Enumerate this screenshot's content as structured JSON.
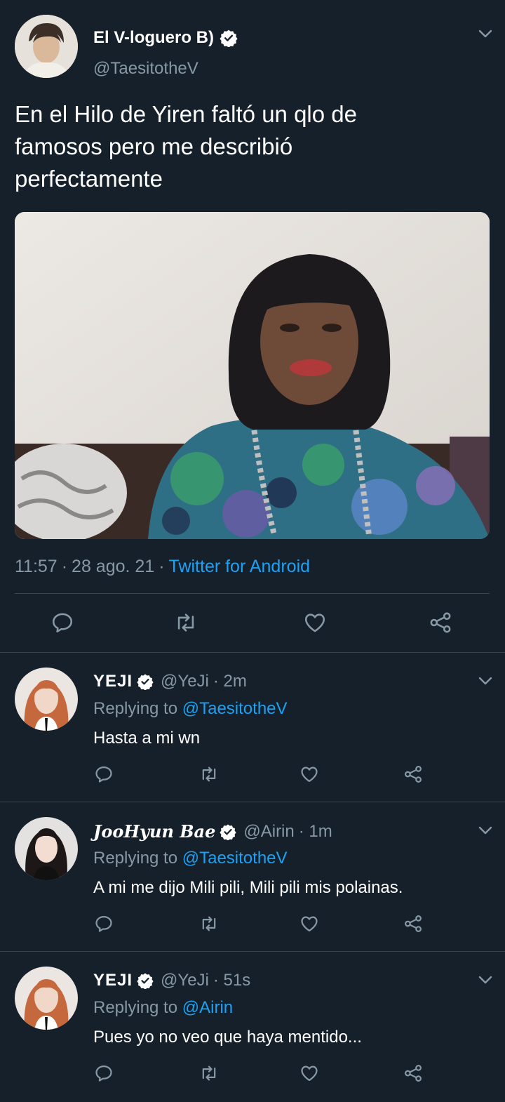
{
  "colors": {
    "background": "#15202b",
    "text": "#ffffff",
    "muted": "#8899a6",
    "link": "#1da1f2",
    "divider": "#38444d"
  },
  "main_tweet": {
    "display_name": "El V-loguero B)",
    "handle": "@TaesitotheV",
    "text": "En el Hilo de Yiren faltó un qlo de famosos pero me describió perfectamente",
    "time": "11:57",
    "date": "28 ago. 21",
    "source": "Twitter for Android",
    "icons": [
      "reply-icon",
      "retweet-icon",
      "like-icon",
      "share-icon",
      "chevron-down-icon",
      "verified-icon"
    ]
  },
  "replies": [
    {
      "display_name": "YEJI",
      "handle": "@YeJi",
      "time": "· 2m",
      "replying_label": "Replying to",
      "replying_to": "@TaesitotheV",
      "text": "Hasta a mi wn"
    },
    {
      "display_name": "JooHyun Bae",
      "handle": "@Airin",
      "time": "· 1m",
      "replying_label": "Replying to",
      "replying_to": "@TaesitotheV",
      "text": "A mi me dijo Mili pili, Mili pili mis polainas."
    },
    {
      "display_name": "YEJI",
      "handle": "@YeJi",
      "time": "· 51s",
      "replying_label": "Replying to",
      "replying_to": "@Airin",
      "text": "Pues yo no veo que haya mentido..."
    }
  ]
}
